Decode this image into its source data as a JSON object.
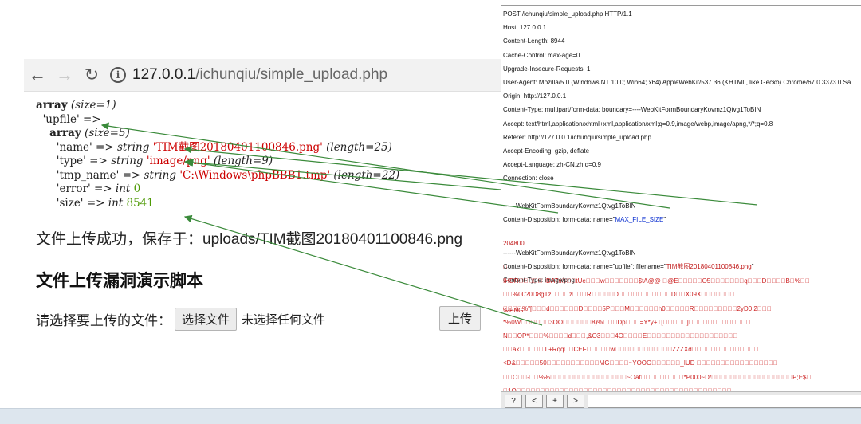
{
  "browser": {
    "back_icon": "←",
    "forward_icon": "→",
    "reload_icon": "↻",
    "info_icon": "i",
    "url_host": "127.0.0.1",
    "url_path": "/ichunqiu/simple_upload.php"
  },
  "dump": {
    "l1_kw": "array",
    "l1_size": "(size=1)",
    "l2_key": "'upfile'",
    "l2_arrow": "=>",
    "l3_kw": "array",
    "l3_size": "(size=5)",
    "rows": [
      {
        "key": "'name'",
        "type": "string",
        "value": "'TIM截图20180401100846.png'",
        "len": "(length=25)"
      },
      {
        "key": "'type'",
        "type": "string",
        "value": "'image/png'",
        "len": "(length=9)"
      },
      {
        "key": "'tmp_name'",
        "type": "string",
        "value": "'C:\\Windows\\phpBBB1.tmp'",
        "len": "(length=22)"
      },
      {
        "key": "'error'",
        "type": "int",
        "value": "0"
      },
      {
        "key": "'size'",
        "type": "int",
        "value": "8541"
      }
    ]
  },
  "page": {
    "success_msg": "文件上传成功，保存于：uploads/TIM截图20180401100846.png",
    "heading": "文件上传漏洞演示脚本",
    "file_label": "请选择要上传的文件：",
    "choose_button": "选择文件",
    "no_file_text": "未选择任何文件",
    "upload_button": "上传"
  },
  "request": {
    "lines": [
      "POST /ichunqiu/simple_upload.php HTTP/1.1",
      "Host: 127.0.0.1",
      "Content-Length: 8944",
      "Cache-Control: max-age=0",
      "Upgrade-Insecure-Requests: 1",
      "User-Agent: Mozilla/5.0 (Windows NT 10.0; Win64; x64) AppleWebKit/537.36 (KHTML, like Gecko) Chrome/67.0.3373.0 Sa",
      "Origin: http://127.0.0.1",
      "Content-Type: multipart/form-data; boundary=----WebKitFormBoundaryKovmz1Qtvg1ToBIN",
      "Accept: text/html,application/xhtml+xml,application/xml;q=0.9,image/webp,image/apng,*/*;q=0.8",
      "Referer: http://127.0.0.1/ichunqiu/simple_upload.php",
      "Accept-Encoding: gzip, deflate",
      "Accept-Language: zh-CN,zh;q=0.9",
      "Connection: close"
    ],
    "boundary1": "------WebKitFormBoundaryKovmz1Qtvg1ToBIN",
    "disp1_prefix": "Content-Disposition: form-data; name=\"",
    "disp1_name": "MAX_FILE_SIZE",
    "disp1_suffix": "\"",
    "max_value": "204800",
    "boundary2": "------WebKitFormBoundaryKovmz1Qtvg1ToBIN",
    "disp2_prefix": "Content-Disposition: form-data; name=\"upfile\"; filename=\"",
    "disp2_filename": "TIM截图20180401100846.png",
    "disp2_suffix": "\"",
    "ctype": "Content-Type: image/png",
    "png_marker": "‰PNG",
    "binary_lines": [
      "\u0000",
      "IHDR\u0000\u0000\u0000\u0000\u0000 IDATx\u0000\u0000\u0000tUe\u0000\u0000\u0000w\u0000\u0000\u0000\u0000\u0000\u0000\u0000$tA@@ \u0000@E\u0000\u0000\u0000\u0000\u0000O5\u0000\u0000\u0000\u0000\u0000\u0000\u0000q\u0000\u0000\u0000D\u0000\u0000\u0000\u0000B\u0000%\u0000\u0000",
      "\u0000\u0000%00?0D8gTzL\u0000\u0000\u0000z\u0000\u0000\u0000RL\u0000\u0000\u0000\u0000D\u0000\u0000\u0000\u0000\u0000\u0000\u0000\u0000\u0000\u0000\u0000D\u0000\u0000X09X\u0000\u0000\u0000\u0000\u0000\u0000\u0000",
      "\u0000\u0000\u0000\u0000%\"[\u0000\u0000\u0000d\u0000\u0000\u0000\u0000\u0000\u0000D\u0000\u0000\u0000\u00005P\u0000\u0000\u0000M\u0000\u0000\u0000\u0000\u0000\u0000h0\u0000\u0000\u0000\u0000\u0000R\u0000\u0000\u0000\u0000\u0000\u0000\u0000\u0000\u00002yD0;2\u0000\u0000\u0000",
      "*%0W\u0000\u0000\u0000\u0000\u0000\u00003OO\u0000\u0000\u0000\u0000\u0000\u00008)%\u0000\u0000\u0000Dp\u0000\u0000\u0000=Y*y+T[\u0000\u0000\u0000\u0000\u0000]\u0000\u0000\u0000\u0000\u0000\u0000\u0000\u0000\u0000\u0000\u0000\u0000\u0000",
      "N\u0000\u0000OP*\u0000\u0000\u0000%\u0000\u0000\u0000\u0000d\u0000\u0000\u0000,&O3\u0000\u0000\u00004O\u0000\u0000\u0000\u0000E\u0000\u0000\u0000\u0000\u0000\u0000\u0000\u0000\u0000\u0000\u0000\u0000\u0000\u0000\u0000\u0000\u0000\u0000\u0000",
      "\u0000\u0000ak\u0000\u0000\u0000\u0000\u0000.I.+Rqq\u0000\u0000CEF\u0000\u0000\u0000\u0000\u0000w\u0000\u0000\u0000\u0000\u0000\u0000\u0000\u0000\u0000\u0000\u0000\u0000ZZZXd\u0000\u0000\u0000\u0000\u0000\u0000\u0000\u0000\u0000\u0000\u0000\u0000\u0000\u0000",
      "<D&\u0000\u0000\u0000\u0000\u000050\u0000\u0000\u0000\u0000\u0000\u0000\u0000\u0000\u0000\u0000\u0000MG\u0000\u0000\u0000\u0000~YOOO\u0000\u0000\u0000\u0000\u0000\u0000_IUD \u0000\u0000\u0000\u0000\u0000\u0000\u0000\u0000\u0000\u0000\u0000\u0000\u0000\u0000\u0000\u0000\u0000",
      "\u0000\u0000O\u0000\u0000-\u0000\u0000%%\u0000\u0000\u0000\u0000\u0000\u0000\u0000\u0000\u0000\u0000\u0000\u0000\u0000\u0000\u0000\u0000~Oaf\u0000\u0000\u0000\u0000\u0000\u0000\u0000\u0000\u0000*P000~D/\u0000\u0000\u0000\u0000\u0000\u0000\u0000\u0000\u0000\u0000\u0000\u0000\u0000\u0000\u0000\u0000\u0000P;E$\u0000",
      "\u00001O\u0000\u0000\u0000\u0000\u0000\u0000\u0000\u0000\u0000\u0000\u0000\u0000\u0000\u0000\u0000\u0000\u0000\u0000\u0000\u0000\u0000\u0000\u0000\u0000\u0000\u0000\u0000\u0000\u0000\u0000\u0000\u0000\u0000\u0000\u0000\u0000\u0000\u0000\u0000\u0000\u0000\u0000\u0000\u0000\u0000",
      "\u0000\u0000m0\u0000\u0000#Ug@\u0000Q#Y\u0000\u0000bzx\u0000\u0000P\u0000\u0000\u0000\u0000\u0000\u0000u\u0000\u0000\u0000\u0000\u0000\u0000\u0000\u0000\u0000\u0000\u0000\u0000\u0000\u0000\u0000\u0000\u0000\u0000\u0000\u0000\u0000\u0000\u0000\u0000\u0000\u0000\u0000\u0000\u0000",
      "Os[0\u0000\u0000\u0000\u0000\u0000\u0000\u0000\u0000\u0000\u0000\u0000\u0000\u0000\u0000\u0000\u0000\u0000TN\u0000\u0000\u0000\u0000\u0000\u0000\u0000\u0000\u0000\u0000\u0000\u0000\u0000\u0000\u0000\u0000\u0000\u0000\u0000\u0000\u0000\u0000\u0000\u0000\u0000\u0000",
      "O3w\u0000\u0000\u0000\u0000\u0000\u0000\u0000\u0000\u0000\u0000\u0000\u0000\u0000\u0000\u0000\u0000\u0000\u0000\u0000\u0000\u0000\u0000\u0000\u0000\u0000\u0000\u0000\u0000\u0000\u0000\u0000\u0000\u0000\u0000\u0000\u0000\u0000\u0000\u0000\u0000\u0000",
      "\u0000\u0000X\u0000\u0000\u0000\u0000\u0000\u0000\u0000\u0000\u0000\u0000\u0000\u0000\u0000\u0000\u0000\u0000\u0000\u0000\u0000\u0000\u0000\u0000\u0000\u0000\u0000\u0000\u0000\u0000\u0000\u0000\u0000\u0000\u0000\u0000\u0000\u0000\u0000\u0000\u0000",
      "\u0000\u0000\u0000\u0000\u0000\u0000 D\u0000\u0000\u0000\u0000\u0000\u0000\u0000\u0000\u0000\u0000\u0000\u0000\u0000\u0000\u0000\u0000\u0000\u0000\u0000\u0000\u0000\u0000RRR~\u0000\u0000\u0000HYLD9 ;~\u0000\u0000\u0000\u0000\u0000"
    ],
    "footer_buttons": [
      "?",
      "<",
      "+",
      ">"
    ]
  }
}
